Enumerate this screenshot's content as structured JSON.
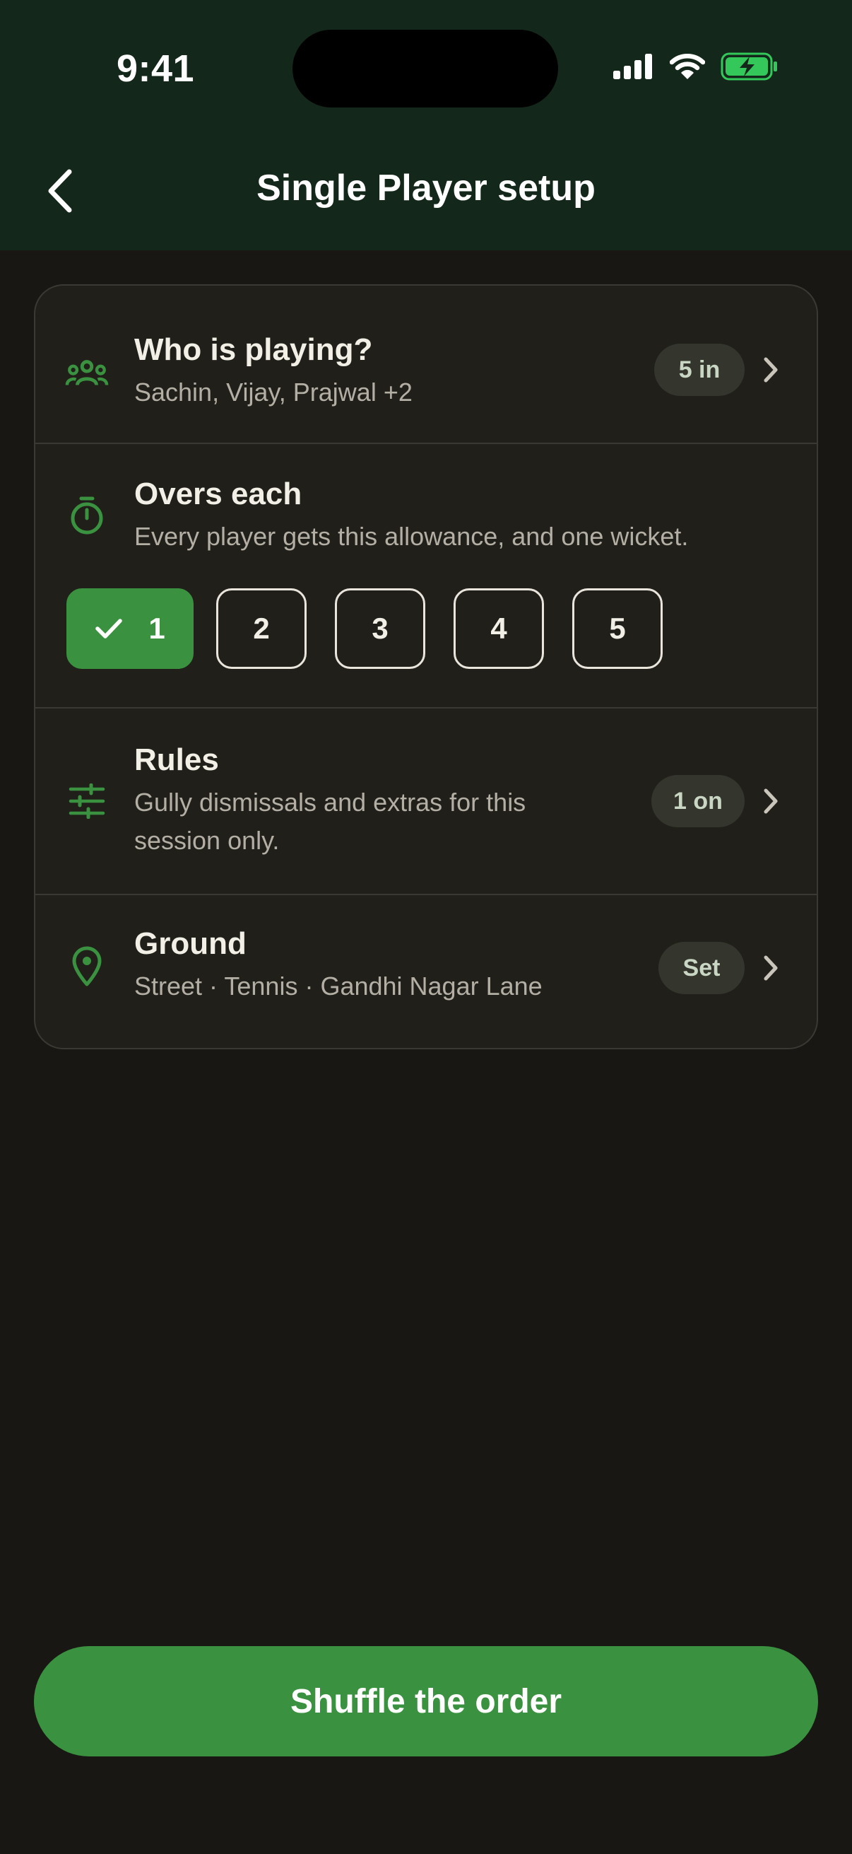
{
  "status_bar": {
    "time": "9:41"
  },
  "header": {
    "title": "Single Player setup"
  },
  "sections": {
    "players": {
      "title": "Who is playing?",
      "subtitle": "Sachin, Vijay, Prajwal +2",
      "badge": "5 in"
    },
    "overs": {
      "title": "Overs each",
      "subtitle": "Every player gets this allowance, and one wicket.",
      "options": [
        "1",
        "2",
        "3",
        "4",
        "5"
      ],
      "selected": "1"
    },
    "rules": {
      "title": "Rules",
      "subtitle_line1": "Gully dismissals and extras for this",
      "subtitle_line2": "session only.",
      "badge": "1 on"
    },
    "ground": {
      "title": "Ground",
      "subtitle": "Street · Tennis · Gandhi Nagar Lane",
      "badge": "Set"
    }
  },
  "cta": {
    "label": "Shuffle the order"
  },
  "colors": {
    "accent": "#3A913F",
    "header_bg": "#13271A",
    "background": "#181713",
    "battery": "#34C759"
  },
  "icons": [
    "back-chevron-icon",
    "cellular-signal-icon",
    "wifi-icon",
    "battery-charging-icon",
    "group-icon",
    "timer-icon",
    "sliders-icon",
    "location-pin-icon",
    "chevron-right-icon",
    "check-icon"
  ]
}
